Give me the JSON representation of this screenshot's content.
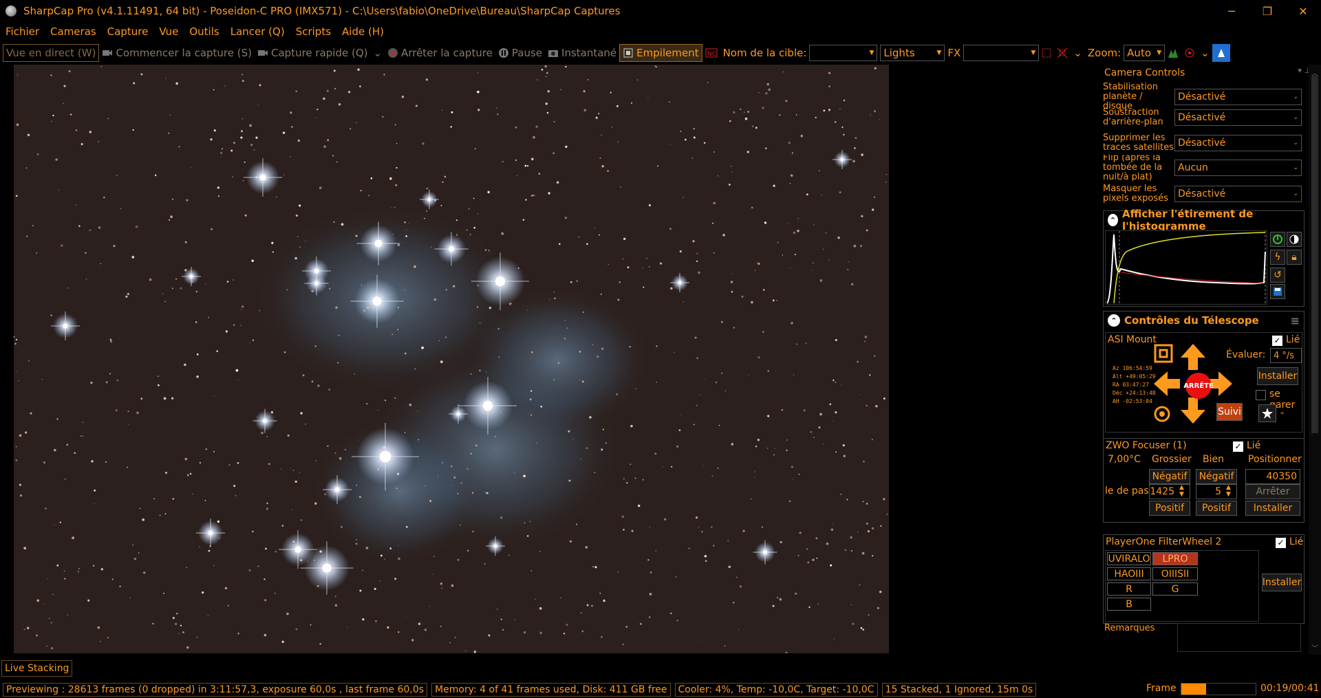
{
  "window": {
    "title": "SharpCap Pro (v4.1.11491, 64 bit) - Poseidon-C PRO (IMX571) - C:\\Users\\fabio\\OneDrive\\Bureau\\SharpCap Captures"
  },
  "menu": [
    "Fichier",
    "Cameras",
    "Capture",
    "Vue",
    "Outils",
    "Lancer (Q)",
    "Scripts",
    "Aide (H)"
  ],
  "toolbar": {
    "live_view": "Vue en direct (W)",
    "start_capture": "Commencer la capture (S)",
    "quick_capture": "Capture rapide (Q)",
    "stop_capture": "Arrêter la capture",
    "pause": "Pause",
    "snapshot": "Instantané",
    "stacking": "Empilement",
    "target_label": "Nom de la cible:",
    "target_value": "",
    "frame_type": "Lights",
    "fx_label": "FX",
    "fx_value": "",
    "zoom_label": "Zoom:",
    "zoom_value": "Auto"
  },
  "camera_controls": {
    "title": "Camera Controls",
    "rows": [
      {
        "label": "Stabilisation planète / disque",
        "value": "Désactivé"
      },
      {
        "label": "Soustraction d'arrière-plan",
        "value": "Désactivé"
      },
      {
        "label": "Supprimer les traces satellites",
        "value": "Désactivé"
      },
      {
        "label": "Flip (après la tombée de la nuit/à plat)",
        "value": "Aucun"
      },
      {
        "label": "Masquer les pixels exposés",
        "value": "Désactivé"
      }
    ]
  },
  "histogram": {
    "title": "Afficher l'étirement de l'histogramme"
  },
  "telescope": {
    "title": "Contrôles du Télescope",
    "mount_name": "ASI Mount",
    "linked_label": "Lié",
    "rate_label": "Évaluer:",
    "rate_value": "4 °/s",
    "install": "Installer",
    "park": "se garer",
    "stop": "ARRÊTE",
    "track": "Suivi",
    "coords": [
      "Az   106:54:59",
      "Alt  +49:05:29",
      "RA    03:47:27",
      "Déc  +24:13:48",
      "AH   -02:53:04"
    ]
  },
  "focuser": {
    "name": "ZWO Focuser (1)",
    "linked_label": "Lié",
    "temp": "7,00°C",
    "coarse": "Grossier",
    "fine": "Bien",
    "positioner": "Positionner",
    "negative": "Négatif",
    "positive": "Positif",
    "position": "40350",
    "step_label": "le de pas",
    "coarse_step": "1425",
    "fine_step": "5",
    "stop": "Arrêter",
    "install": "Installer"
  },
  "filterwheel": {
    "name": "PlayerOne FilterWheel 2",
    "linked_label": "Lié",
    "filters": [
      "UVIRALO",
      "LPRO",
      "HAOIII",
      "OIIISII",
      "R",
      "G",
      "B"
    ],
    "selected": "LPRO",
    "install": "Installer",
    "notes_label": "Remarques"
  },
  "live_stacking_tab": "Live Stacking",
  "status": {
    "preview": "Previewing : 28613 frames (0 dropped) in 3:11:57,3, exposure 60,0s , last frame 60,0s",
    "memory": "Memory: 4 of 41 frames used, Disk: 411 GB free",
    "cooler": "Cooler: 4%, Temp: -10,0C, Target: -10,0C",
    "stack": "15 Stacked, 1 Ignored, 15m 0s",
    "frame_label": "Frame :",
    "frame_progress": 0.33,
    "frame_time": "00:19/00:41"
  },
  "colors": {
    "accent": "#ff9a1f",
    "selected_filter": "#b5341a",
    "stop_red": "#e81010"
  }
}
